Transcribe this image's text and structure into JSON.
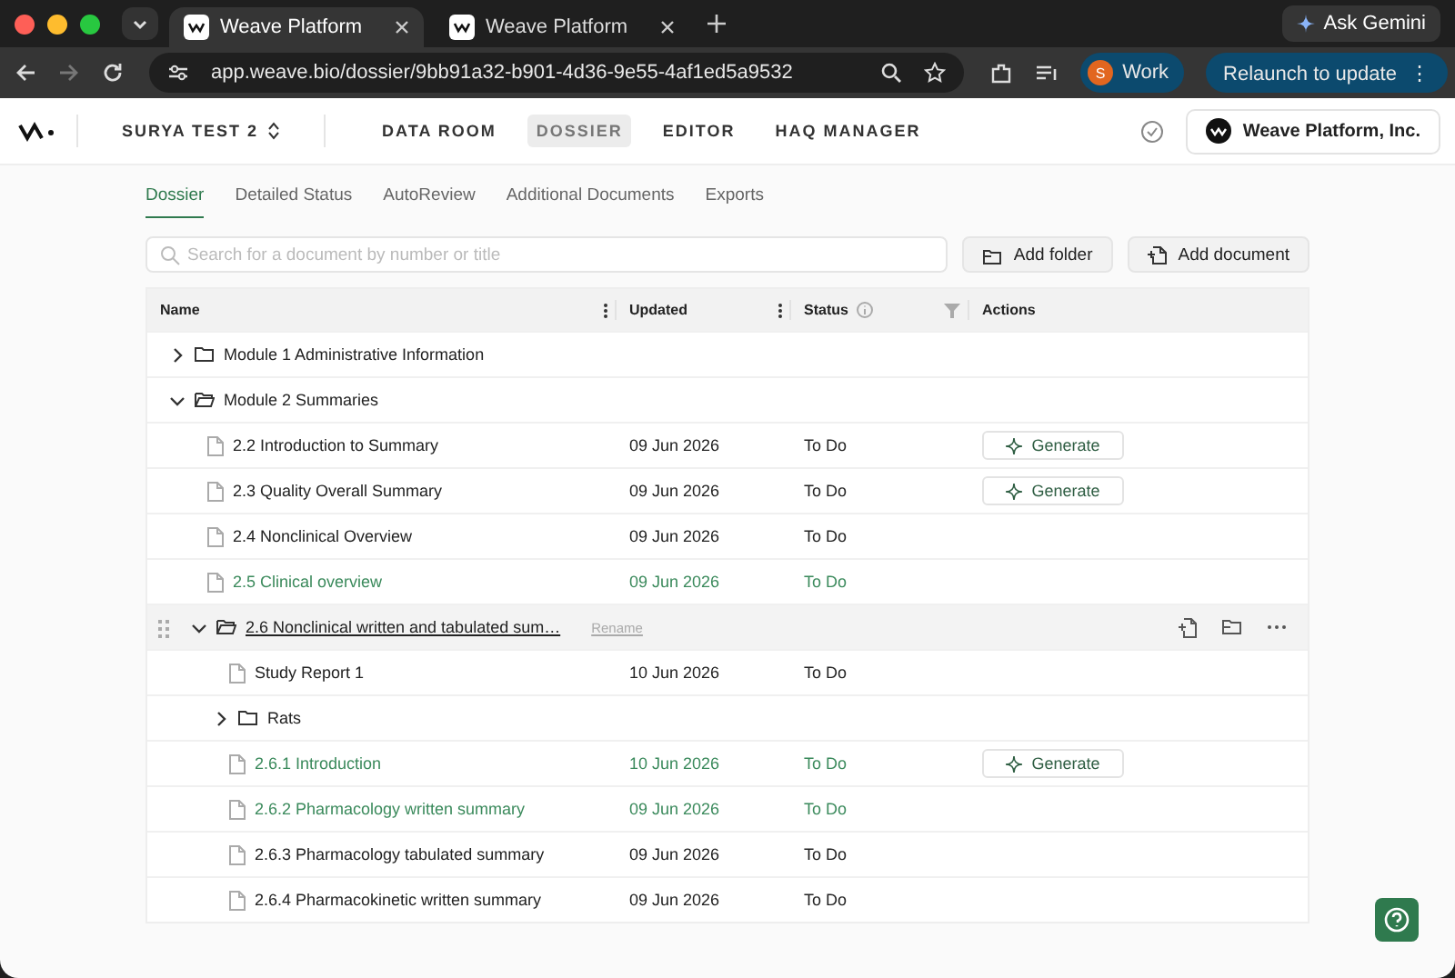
{
  "browser": {
    "tabs": [
      {
        "title": "Weave Platform",
        "selected": true
      },
      {
        "title": "Weave Platform",
        "selected": false
      }
    ],
    "url": "app.weave.bio/dossier/9bb91a32-b901-4d36-9e55-4af1ed5a9532",
    "profile": {
      "initial": "S",
      "label": "Work"
    },
    "relaunch": "Relaunch to update",
    "relaunch_menu": "⋮",
    "gemini": "Ask Gemini"
  },
  "app_nav": {
    "project": "SURYA TEST 2",
    "items": [
      {
        "label": "DATA ROOM",
        "selected": false
      },
      {
        "label": "DOSSIER",
        "selected": true
      },
      {
        "label": "EDITOR",
        "selected": false
      },
      {
        "label": "HAQ MANAGER",
        "selected": false
      }
    ],
    "org": "Weave Platform, Inc."
  },
  "tabs": [
    {
      "label": "Dossier",
      "selected": true
    },
    {
      "label": "Detailed Status",
      "selected": false
    },
    {
      "label": "AutoReview",
      "selected": false
    },
    {
      "label": "Additional Documents",
      "selected": false
    },
    {
      "label": "Exports",
      "selected": false
    }
  ],
  "search": {
    "placeholder": "Search for a document by number or title"
  },
  "buttons": [
    "Add folder",
    "Add document"
  ],
  "table": {
    "columns": [
      "Name",
      "Updated",
      "Status",
      "Actions"
    ],
    "rows": [
      {
        "kind": "folder",
        "name": "Module 1 Administrative Information",
        "expanded": false
      },
      {
        "kind": "folder",
        "name": "Module 2 Summaries",
        "expanded": true,
        "children": [
          {
            "kind": "doc",
            "name": "2.2 Introduction to Summary",
            "updated": "09 Jun 2026",
            "status": "To Do",
            "highlighted": false,
            "action": "Generate"
          },
          {
            "kind": "doc",
            "name": "2.3 Quality Overall Summary",
            "updated": "09 Jun 2026",
            "status": "To Do",
            "highlighted": false,
            "action": "Generate"
          },
          {
            "kind": "doc",
            "name": "2.4 Nonclinical Overview",
            "updated": "09 Jun 2026",
            "status": "To Do",
            "highlighted": false
          },
          {
            "kind": "doc",
            "name": "2.5 Clinical overview",
            "updated": "09 Jun 2026",
            "status": "To Do",
            "highlighted": true
          },
          {
            "kind": "folder",
            "name": "2.6 Nonclinical written and tabulated sum…",
            "expanded": true,
            "hovered": true,
            "rename": "Rename",
            "children": [
              {
                "kind": "doc",
                "name": "Study Report 1",
                "updated": "10 Jun 2026",
                "status": "To Do",
                "highlighted": false
              },
              {
                "kind": "folder",
                "name": "Rats",
                "expanded": false
              },
              {
                "kind": "doc",
                "name": "2.6.1 Introduction",
                "updated": "10 Jun 2026",
                "status": "To Do",
                "highlighted": true,
                "action": "Generate"
              },
              {
                "kind": "doc",
                "name": "2.6.2 Pharmacology written summary",
                "updated": "09 Jun 2026",
                "status": "To Do",
                "highlighted": true
              },
              {
                "kind": "doc",
                "name": "2.6.3 Pharmacology tabulated summary",
                "updated": "09 Jun 2026",
                "status": "To Do",
                "highlighted": false
              },
              {
                "kind": "doc",
                "name": "2.6.4 Pharmacokinetic written summary",
                "updated": "09 Jun 2026",
                "status": "To Do",
                "highlighted": false
              }
            ]
          }
        ]
      }
    ]
  }
}
